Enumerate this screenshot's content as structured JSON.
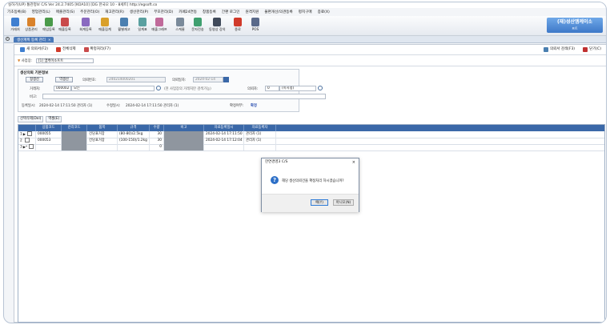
{
  "window": {
    "title": "실하기(UP) 통관정보 C/S  Ver 24.2.7405  [KOA10]  [DG 한국오 10 - 8세트]  http://egsoft.co"
  },
  "menu": [
    "기초등록(B)",
    "영업관리(L)",
    "매출관리(S)",
    "주문관리(O)",
    "재고관리(R)",
    "생산관리(P)",
    "부모관리(D)",
    "카페24연동",
    "창품등록",
    "간편 로그인",
    "원격지원",
    "불편개선/의견등록",
    "평지구매",
    "종료(X)"
  ],
  "toolbar": {
    "buttons": [
      {
        "label": "거래처",
        "icon": "customer-icon",
        "color": "#3f7fd0"
      },
      {
        "label": "상품관리",
        "icon": "product-icon",
        "color": "#d9822b"
      },
      {
        "label": "매입등록",
        "icon": "purchase-icon",
        "color": "#4a9a4a"
      },
      {
        "label": "매출등록",
        "icon": "sales-icon",
        "color": "#c94b4b"
      },
      {
        "label": "회계등록",
        "icon": "accounting-icon",
        "color": "#8a6ac0"
      },
      {
        "label": "매출집계",
        "icon": "sales-summary-icon",
        "color": "#d9a02b"
      },
      {
        "label": "월별재고",
        "icon": "monthly-stock-icon",
        "color": "#4a7fb0"
      },
      {
        "label": "일계표",
        "icon": "daily-report-icon",
        "color": "#5aa0a0"
      },
      {
        "label": "매출그래프",
        "icon": "chart-icon",
        "color": "#c06a9a"
      },
      {
        "label": "스케줄",
        "icon": "schedule-icon",
        "color": "#7a8a9a"
      },
      {
        "label": "문자전송",
        "icon": "sms-icon",
        "color": "#3f9f6f"
      },
      {
        "label": "동영상 강의",
        "icon": "video-icon",
        "color": "#404a5a"
      },
      {
        "label": "종료",
        "icon": "power-icon",
        "color": "#d03a2a"
      },
      {
        "label": "POS",
        "icon": "pos-icon",
        "color": "#5a6a8a"
      }
    ],
    "brand": {
      "name": "(재)성산엠케이소",
      "sub": "프트"
    }
  },
  "tab": {
    "label": "생산계획 등록 관리",
    "close": "×"
  },
  "actions": {
    "new": "새 의뢰서(F2)",
    "delete": "전체삭제",
    "confirm": "확정처리(F7)",
    "search": "의뢰서 검색(F3)",
    "close": "닫기(C)"
  },
  "biz": {
    "label": "사업장:",
    "value": "[1] 엠케이소프트"
  },
  "info": {
    "header": "생산의뢰 기본정보",
    "btn_production": "정생산",
    "btn_reverse": "역생산",
    "req_no_label": "의뢰번호:",
    "req_no": "240214000201",
    "req_date_label": "의뢰일자:",
    "req_date": "2024-02-14",
    "customer_label": "거래처:",
    "customer_code": "000002",
    "customer_name": "모든",
    "customer_hint": "(현 사업장의 거래처만 검색가능)",
    "requester_label": "의뢰자:",
    "requester_code": "0",
    "requester_name": "(미지정)",
    "memo_label": "비고:",
    "reg_label": "등록일시:",
    "reg_value": "2024-02-14 17:11:50 관리자 (1)",
    "mod_label": "수정일시:",
    "mod_value": "2024-02-14 17:11:50 관리자 (1)",
    "confirm_label": "확정여부:",
    "confirm_value": "확정"
  },
  "grid_toolbar": {
    "export": "선택삭제(Del)",
    "view": "엑셀(E)"
  },
  "grid": {
    "columns": [
      "",
      "상품코드",
      "관리코드",
      "품목",
      "규격",
      "수량",
      "비고",
      "자료등록일시",
      "자료등록자"
    ],
    "rows": [
      {
        "num": "1",
        "marker": "▶",
        "code": "000055",
        "mgmt": "",
        "item": "건당표거장",
        "spec": "(80-80)/2.5kg",
        "qty": "30",
        "memo": "",
        "reg_date": "2024-02-14 17:11:50",
        "reg_user": "관리자 (1)"
      },
      {
        "num": "2",
        "marker": "",
        "code": "000053",
        "mgmt": "",
        "item": "건당표거장",
        "spec": "(100-150)/1.2kg",
        "qty": "30",
        "memo": "",
        "reg_date": "2024-02-14 17:12:04",
        "reg_user": "관리자 (1)"
      },
      {
        "num": "3",
        "marker": "▶*",
        "code": "",
        "mgmt": "",
        "item": "",
        "spec": "",
        "qty": "0",
        "memo": "",
        "reg_date": "",
        "reg_user": ""
      }
    ]
  },
  "dialog": {
    "title": "한연경영3 C/S",
    "close": "×",
    "message": "해당 생산의뢰건을 확정처리 하시겠습니까?",
    "yes": "예(Y)",
    "no": "아니오(N)"
  }
}
